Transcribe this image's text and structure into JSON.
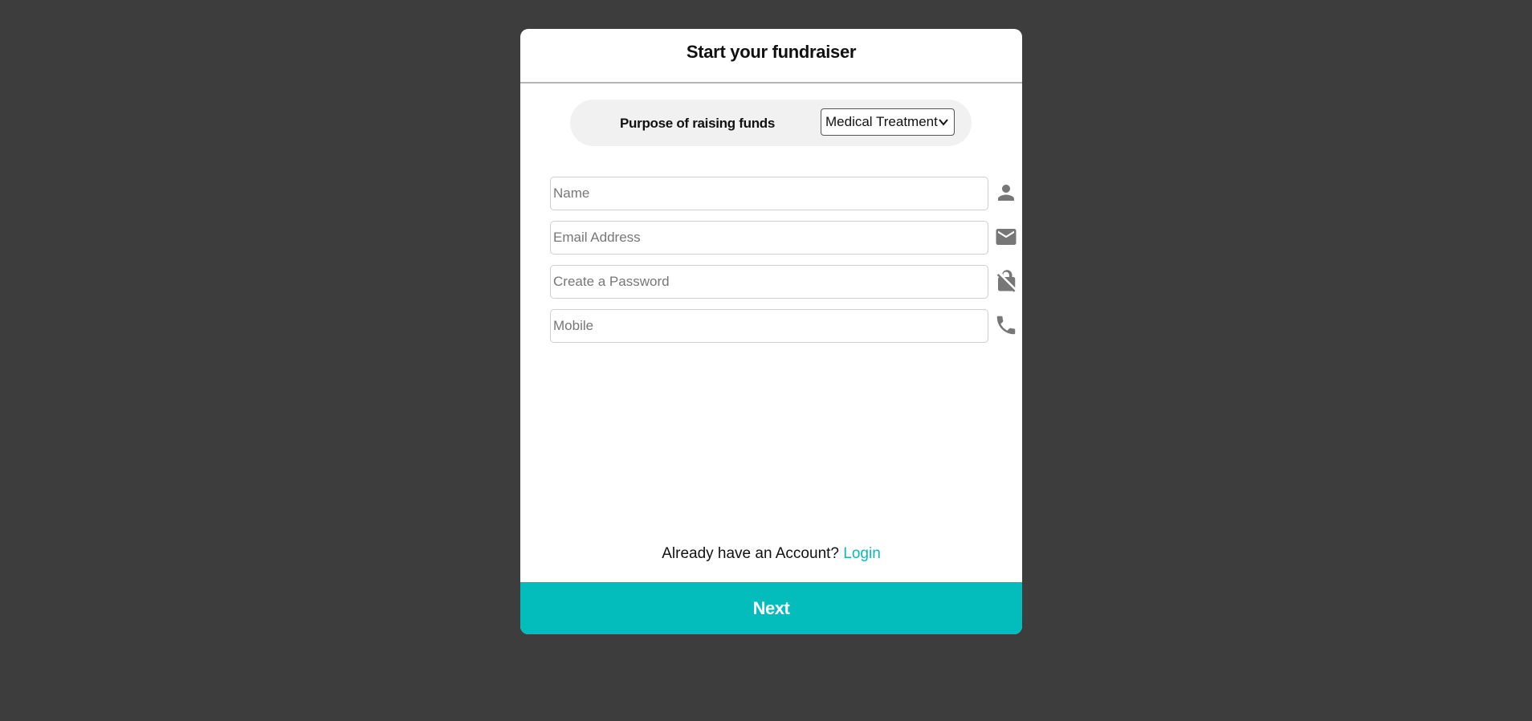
{
  "modal": {
    "title": "Start your fundraiser"
  },
  "purpose": {
    "label": "Purpose of raising funds",
    "selected": "Medical Treatment"
  },
  "fields": {
    "name": {
      "placeholder": "Name",
      "icon": "person-icon"
    },
    "email": {
      "placeholder": "Email Address",
      "icon": "mail-icon"
    },
    "password": {
      "placeholder": "Create a Password",
      "icon": "lock-off-icon"
    },
    "mobile": {
      "placeholder": "Mobile",
      "icon": "phone-icon"
    }
  },
  "footer": {
    "account_text": "Already have an Account?",
    "login_label": "Login",
    "next_label": "Next"
  },
  "colors": {
    "backdrop": "#3d3d3d",
    "accent": "#03bdbd",
    "link": "#10b5b8",
    "icon": "#777777"
  }
}
